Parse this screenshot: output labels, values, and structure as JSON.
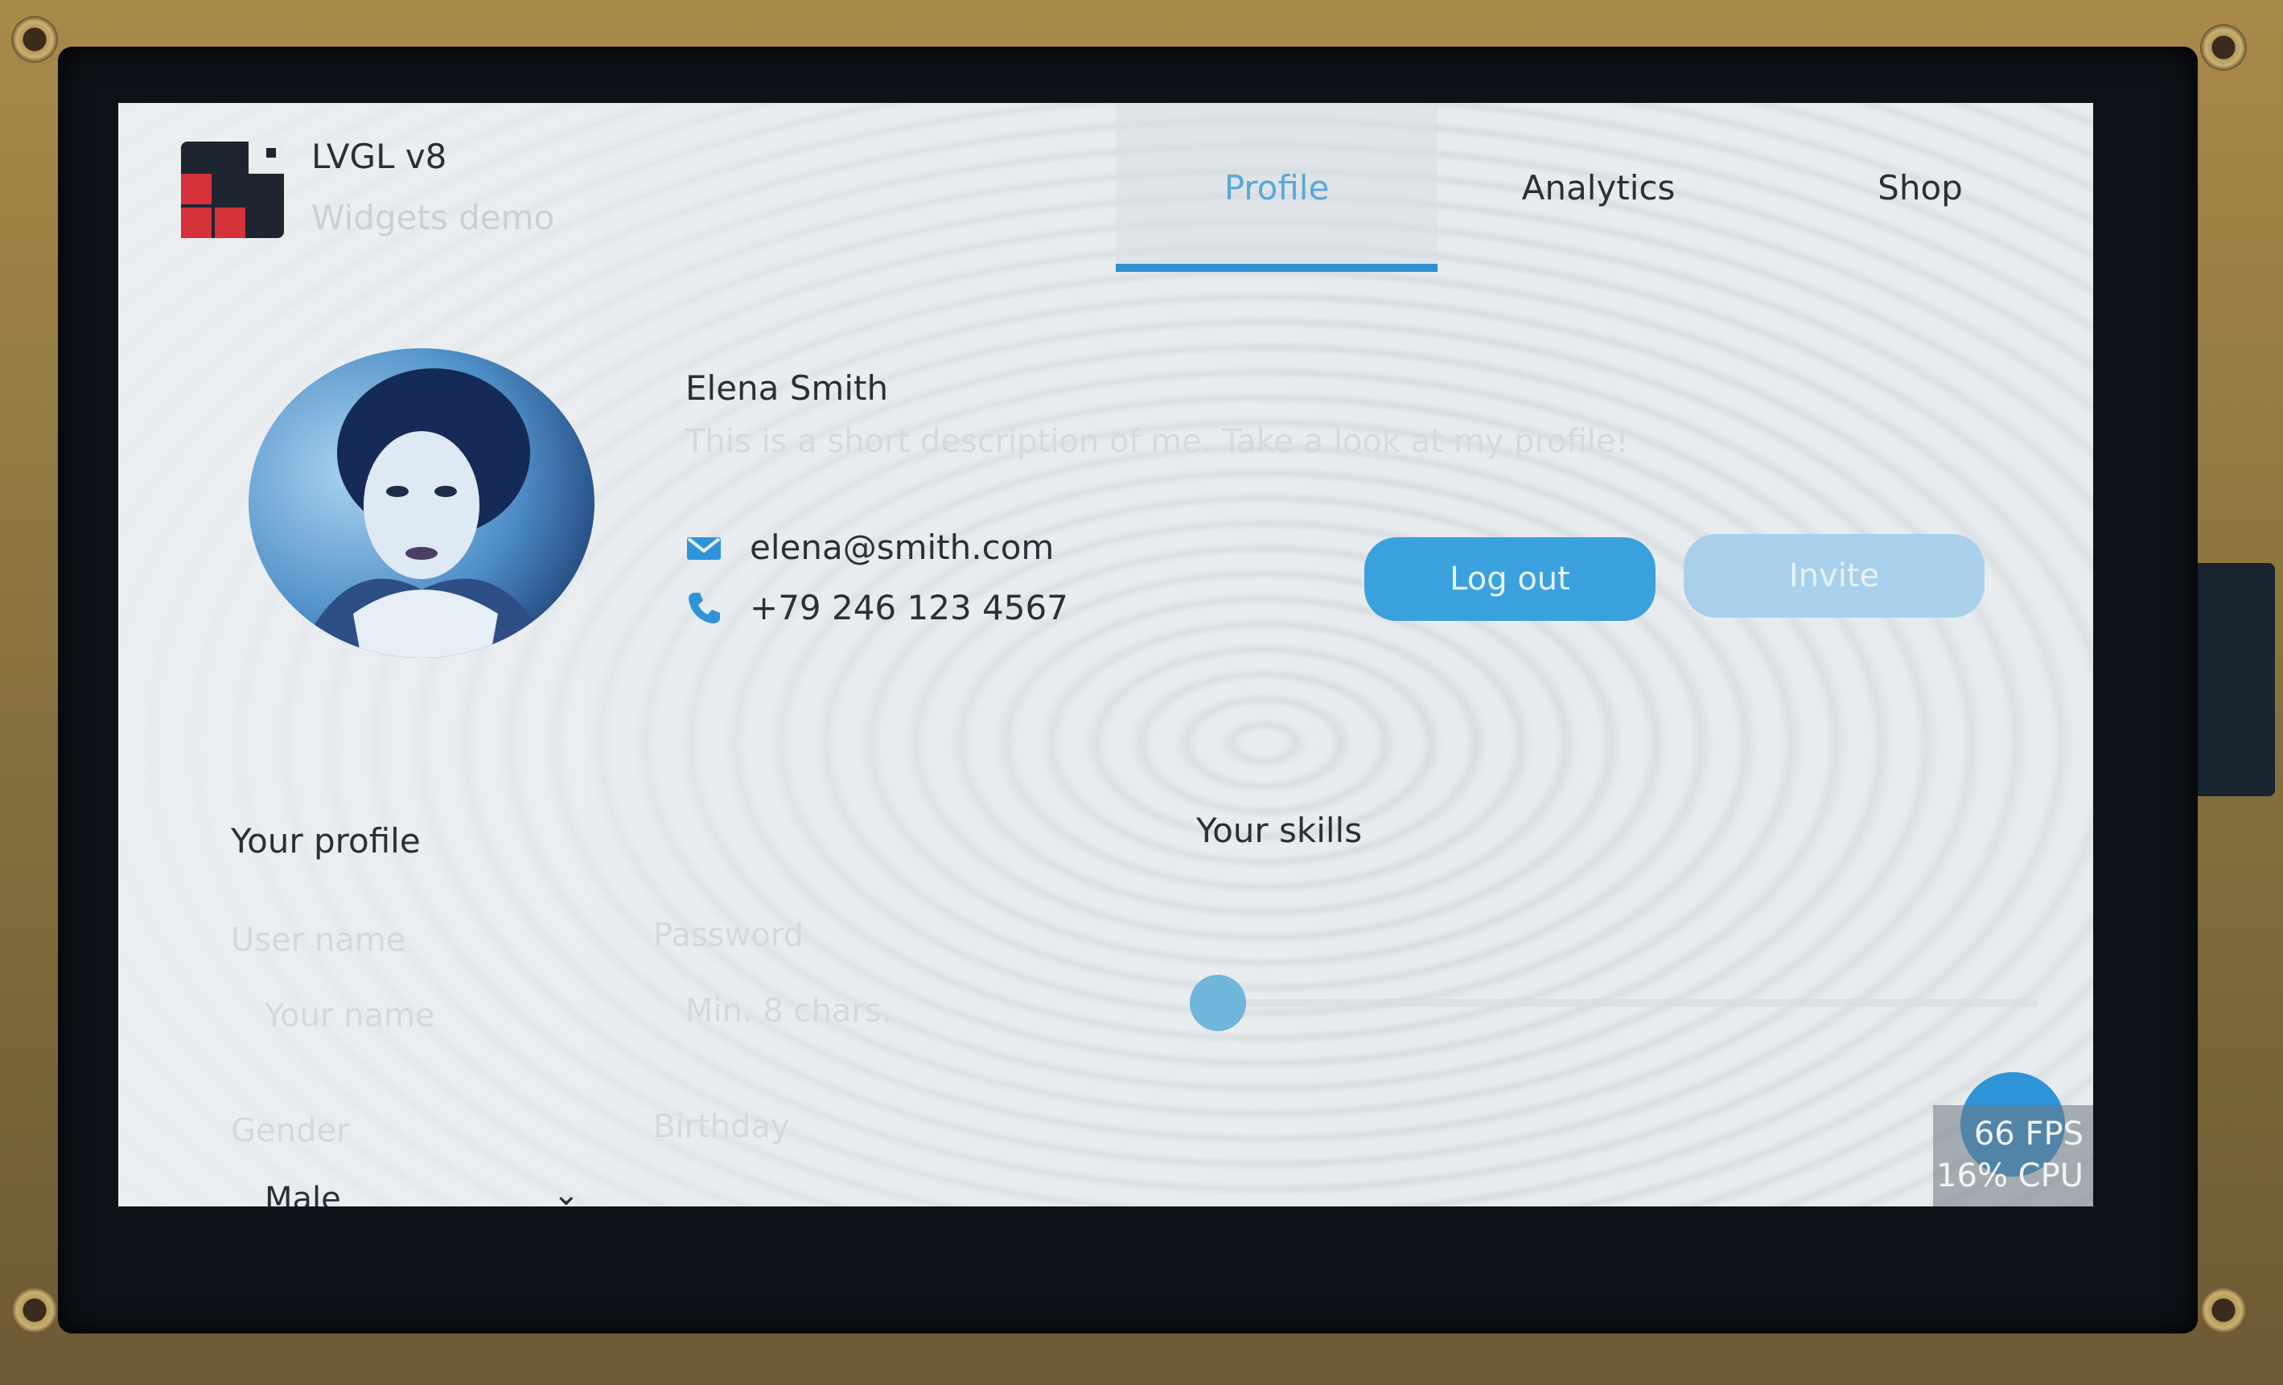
{
  "header": {
    "app_title": "LVGL v8",
    "app_subtitle": "Widgets demo",
    "tabs": [
      {
        "label": "Profile",
        "active": true
      },
      {
        "label": "Analytics",
        "active": false
      },
      {
        "label": "Shop",
        "active": false
      }
    ]
  },
  "profile": {
    "name": "Elena Smith",
    "description": "This is a short description of me. Take a look at my profile!",
    "email": "elena@smith.com",
    "phone": "+79 246 123 4567",
    "logout_label": "Log out",
    "invite_label": "Invite"
  },
  "your_profile": {
    "title": "Your profile",
    "username_label": "User name",
    "username_placeholder": "Your name",
    "password_label": "Password",
    "password_placeholder": "Min. 8 chars.",
    "gender_label": "Gender",
    "gender_value": "Male",
    "birthday_label": "Birthday"
  },
  "your_skills": {
    "title": "Your skills",
    "slider_value": 0
  },
  "perf_monitor": {
    "fps": "66 FPS",
    "cpu": "16% CPU"
  },
  "colors": {
    "accent": "#2f8fd0",
    "button_primary": "#3ba1dc",
    "button_disabled": "#a8d0ea",
    "logo_red": "#d6323a",
    "logo_dark": "#1e2430"
  }
}
